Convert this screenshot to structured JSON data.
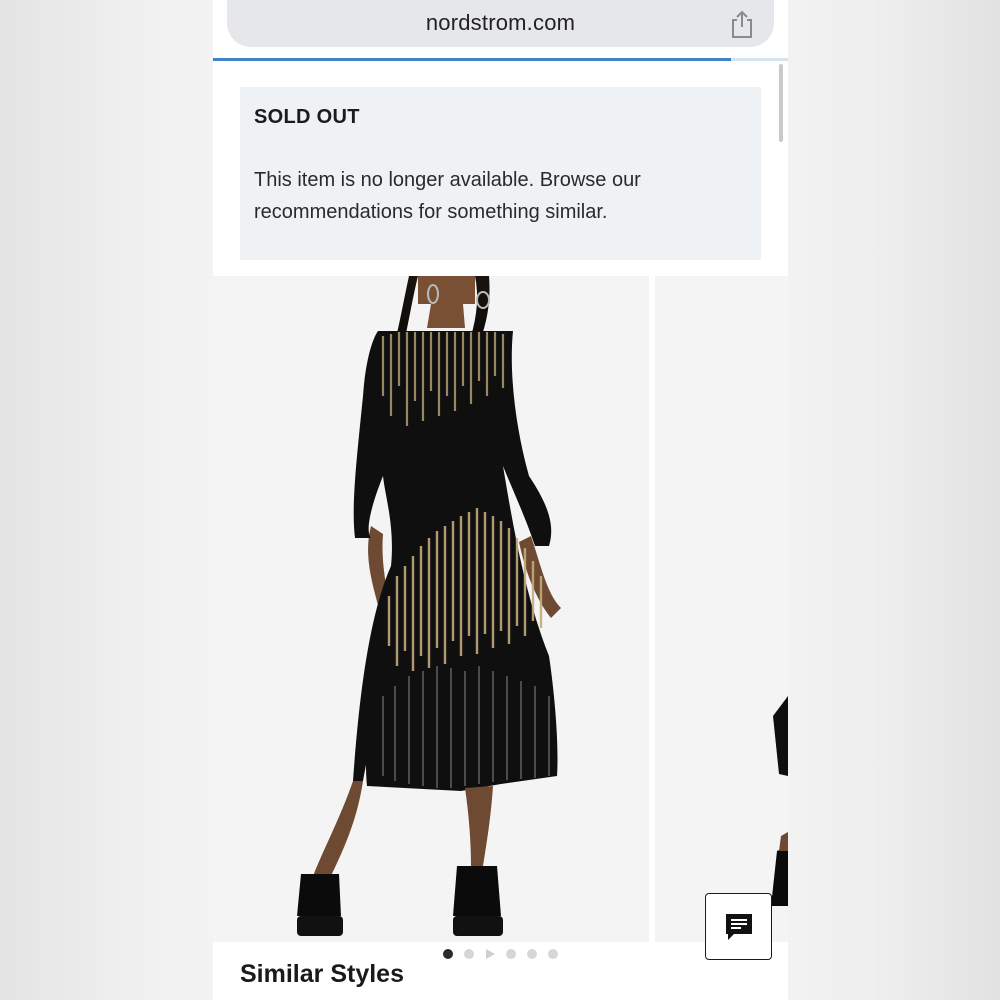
{
  "browser": {
    "url": "nordstrom.com",
    "load_progress_percent": 90
  },
  "notice": {
    "title": "SOLD OUT",
    "message": "This item is no longer available. Browse our recommendations for something similar."
  },
  "gallery": {
    "image_count": 6,
    "active_index": 0,
    "video_index": 2
  },
  "section": {
    "similar_title": "Similar Styles"
  },
  "icons": {
    "share": "share-icon",
    "chat": "chat-icon",
    "play": "play-icon"
  },
  "colors": {
    "progress": "#3f82c6",
    "notice_bg": "#eff2f5",
    "text": "#1b1b1b"
  }
}
